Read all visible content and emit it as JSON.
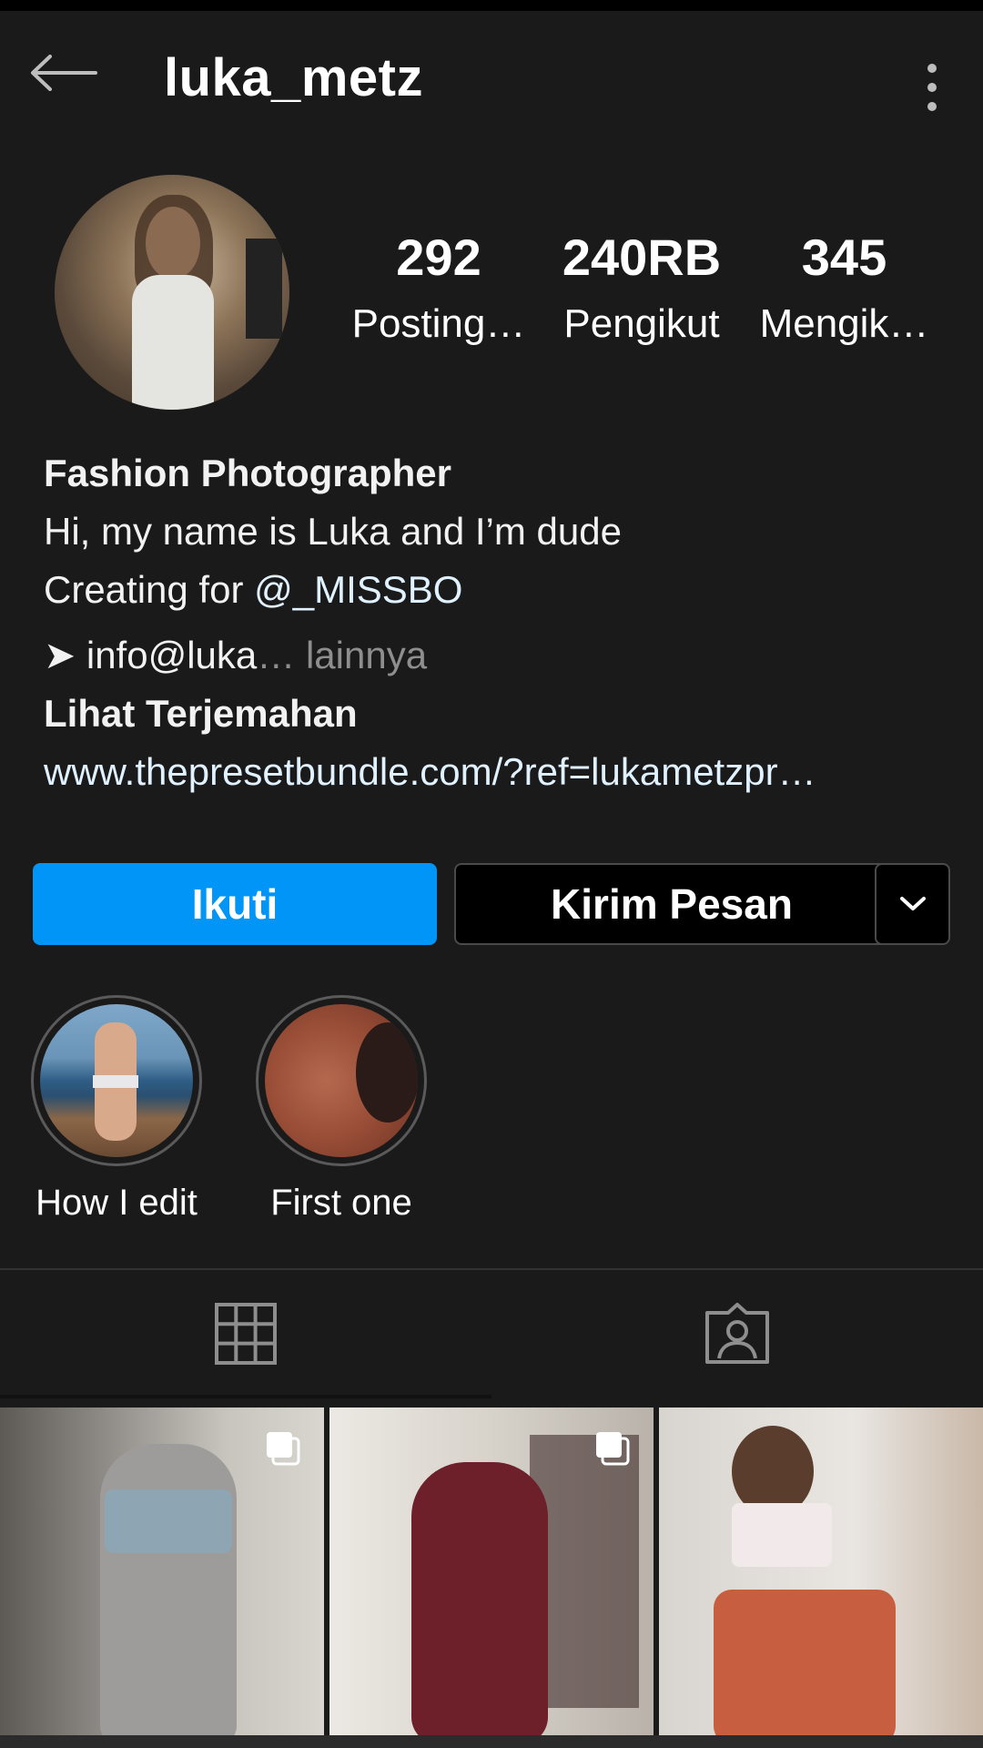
{
  "header": {
    "username": "luka_metz",
    "back_icon": "arrow-left-icon",
    "menu_icon": "more-vertical-icon"
  },
  "profile": {
    "avatar": "profile-photo",
    "stats": [
      {
        "value": "292",
        "label": "Posting…"
      },
      {
        "value": "240RB",
        "label": "Pengikut"
      },
      {
        "value": "345",
        "label": "Mengik…"
      }
    ]
  },
  "bio": {
    "name": "Fashion Photographer",
    "line1": "Hi, my name is Luka and I’m dude",
    "line2_prefix": "Creating for ",
    "line2_mention": "@_MISSBO",
    "line3_arrow": "➤",
    "line3_text": " info@luka",
    "line3_more": "… lainnya",
    "translate": "Lihat Terjemahan",
    "website": "www.thepresetbundle.com/?ref=lukametzpr…"
  },
  "actions": {
    "follow_label": "Ikuti",
    "message_label": "Kirim Pesan",
    "more_icon": "chevron-down-icon"
  },
  "highlights": [
    {
      "label": "How I edit"
    },
    {
      "label": "First one"
    }
  ],
  "tabs": [
    {
      "icon": "grid-icon",
      "active": true
    },
    {
      "icon": "tagged-user-icon",
      "active": false
    }
  ],
  "colors": {
    "background": "#1a1a1a",
    "accent": "#0095f6",
    "link": "#e0f1ff",
    "muted": "#8e8e8e"
  }
}
